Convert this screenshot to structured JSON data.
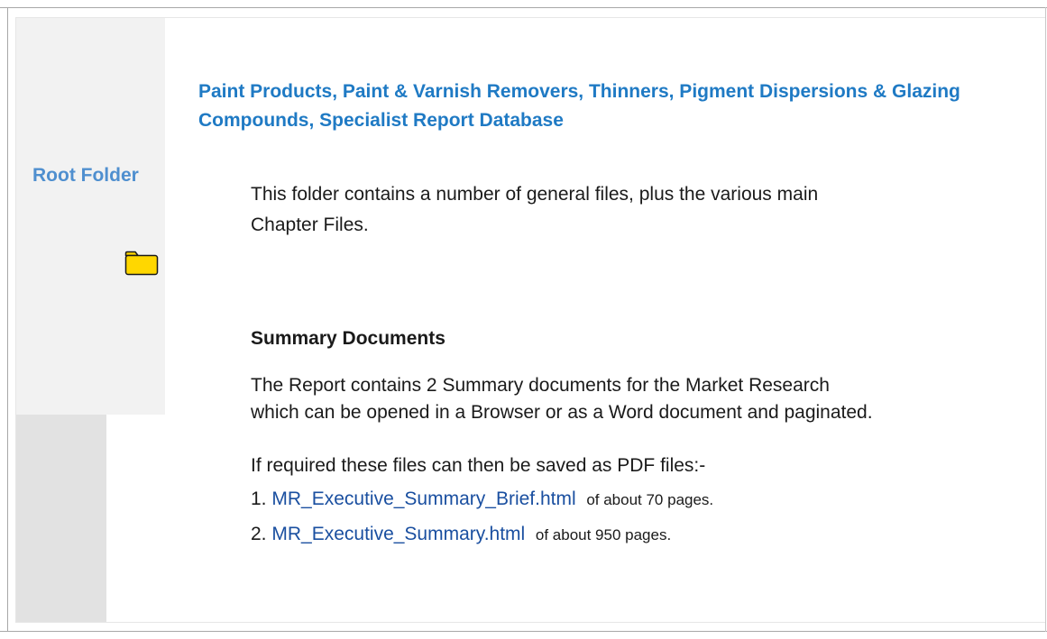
{
  "sidebar": {
    "label": "Root Folder",
    "icon": "folder-icon"
  },
  "main": {
    "title": "Paint Products, Paint & Varnish Removers, Thinners, Pigment Dispersions & Glazing Compounds, Specialist Report Database",
    "intro": "This folder contains a number of general files, plus the various main Chapter Files.",
    "summary_heading": "Summary Documents",
    "summary_description": "The Report contains 2 Summary documents for the Market Research which can be opened in a Browser or as a Word document and paginated.",
    "pdf_note": "If required these files can then be saved as PDF files:-",
    "documents": [
      {
        "number": "1.",
        "link": "MR_Executive_Summary_Brief.html",
        "pages": "of about 70 pages."
      },
      {
        "number": "2.",
        "link": "MR_Executive_Summary.html",
        "pages": "of about 950 pages."
      }
    ]
  },
  "colors": {
    "title": "#1f7ac4",
    "sidebar_label": "#4f8fcf",
    "link": "#1a4fa0",
    "folder_fill": "#ffd700"
  }
}
